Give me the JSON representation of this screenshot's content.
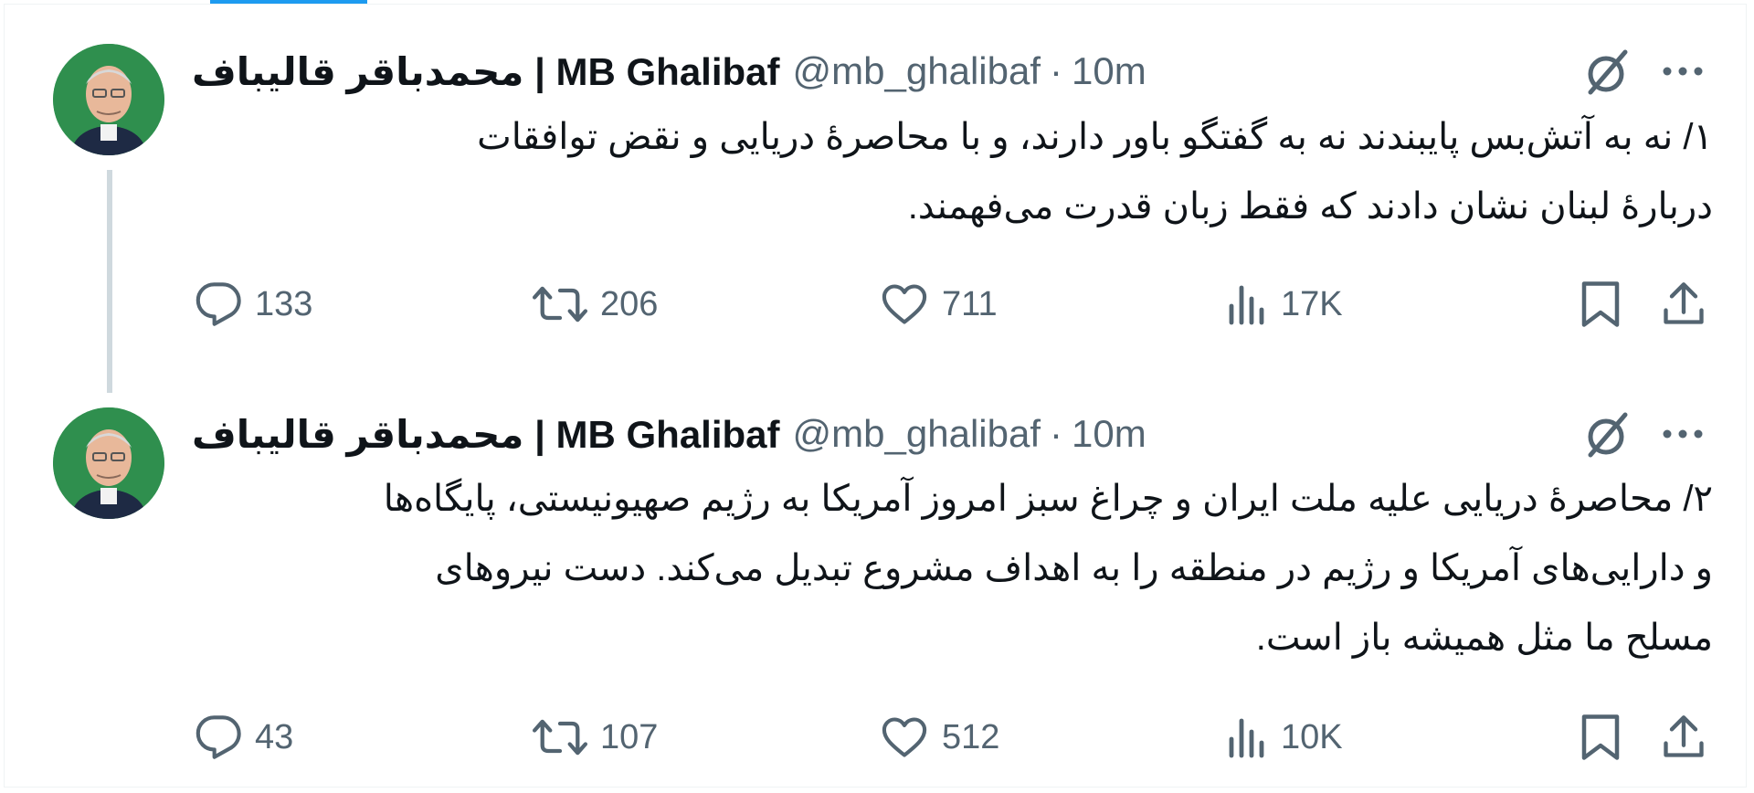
{
  "tweets": [
    {
      "display_name": "محمدباقر قالیباف | MB Ghalibaf",
      "handle": "@mb_ghalibaf",
      "separator": "·",
      "time": "10m",
      "text_lines": [
        "۱/ نه به آتش‌بس پایبندند نه به گفتگو باور دارند، و با محاصرهٔ دریایی و نقض توافقات",
        "دربارهٔ لبنان نشان دادند که فقط زبان قدرت می‌فهمند."
      ],
      "replies": "133",
      "reposts": "206",
      "likes": "711",
      "views": "17K"
    },
    {
      "display_name": "محمدباقر قالیباف | MB Ghalibaf",
      "handle": "@mb_ghalibaf",
      "separator": "·",
      "time": "10m",
      "text_lines": [
        "۲/ محاصرهٔ دریایی علیه ملت ایران و چراغ سبز امروز آمریکا به رژیم صهیونیستی، پایگاه‌ها",
        "و دارایی‌های آمریکا و رژیم در منطقه را به اهداف مشروع تبدیل می‌کند. دست نیروهای",
        "مسلح ما مثل همیشه باز است."
      ],
      "replies": "43",
      "reposts": "107",
      "likes": "512",
      "views": "10K"
    }
  ],
  "icons": {
    "reply": "reply-icon",
    "repost": "repost-icon",
    "like": "heart-icon",
    "views": "views-chart-icon",
    "bookmark": "bookmark-icon",
    "share": "share-icon",
    "grok": "grok-icon",
    "more": "more-dots-icon"
  },
  "colors": {
    "text": "#0f1419",
    "secondary": "#536471",
    "accent": "#1d9bf0",
    "thread_line": "#cfd9de",
    "avatar_bg": "#2f8f4e"
  }
}
